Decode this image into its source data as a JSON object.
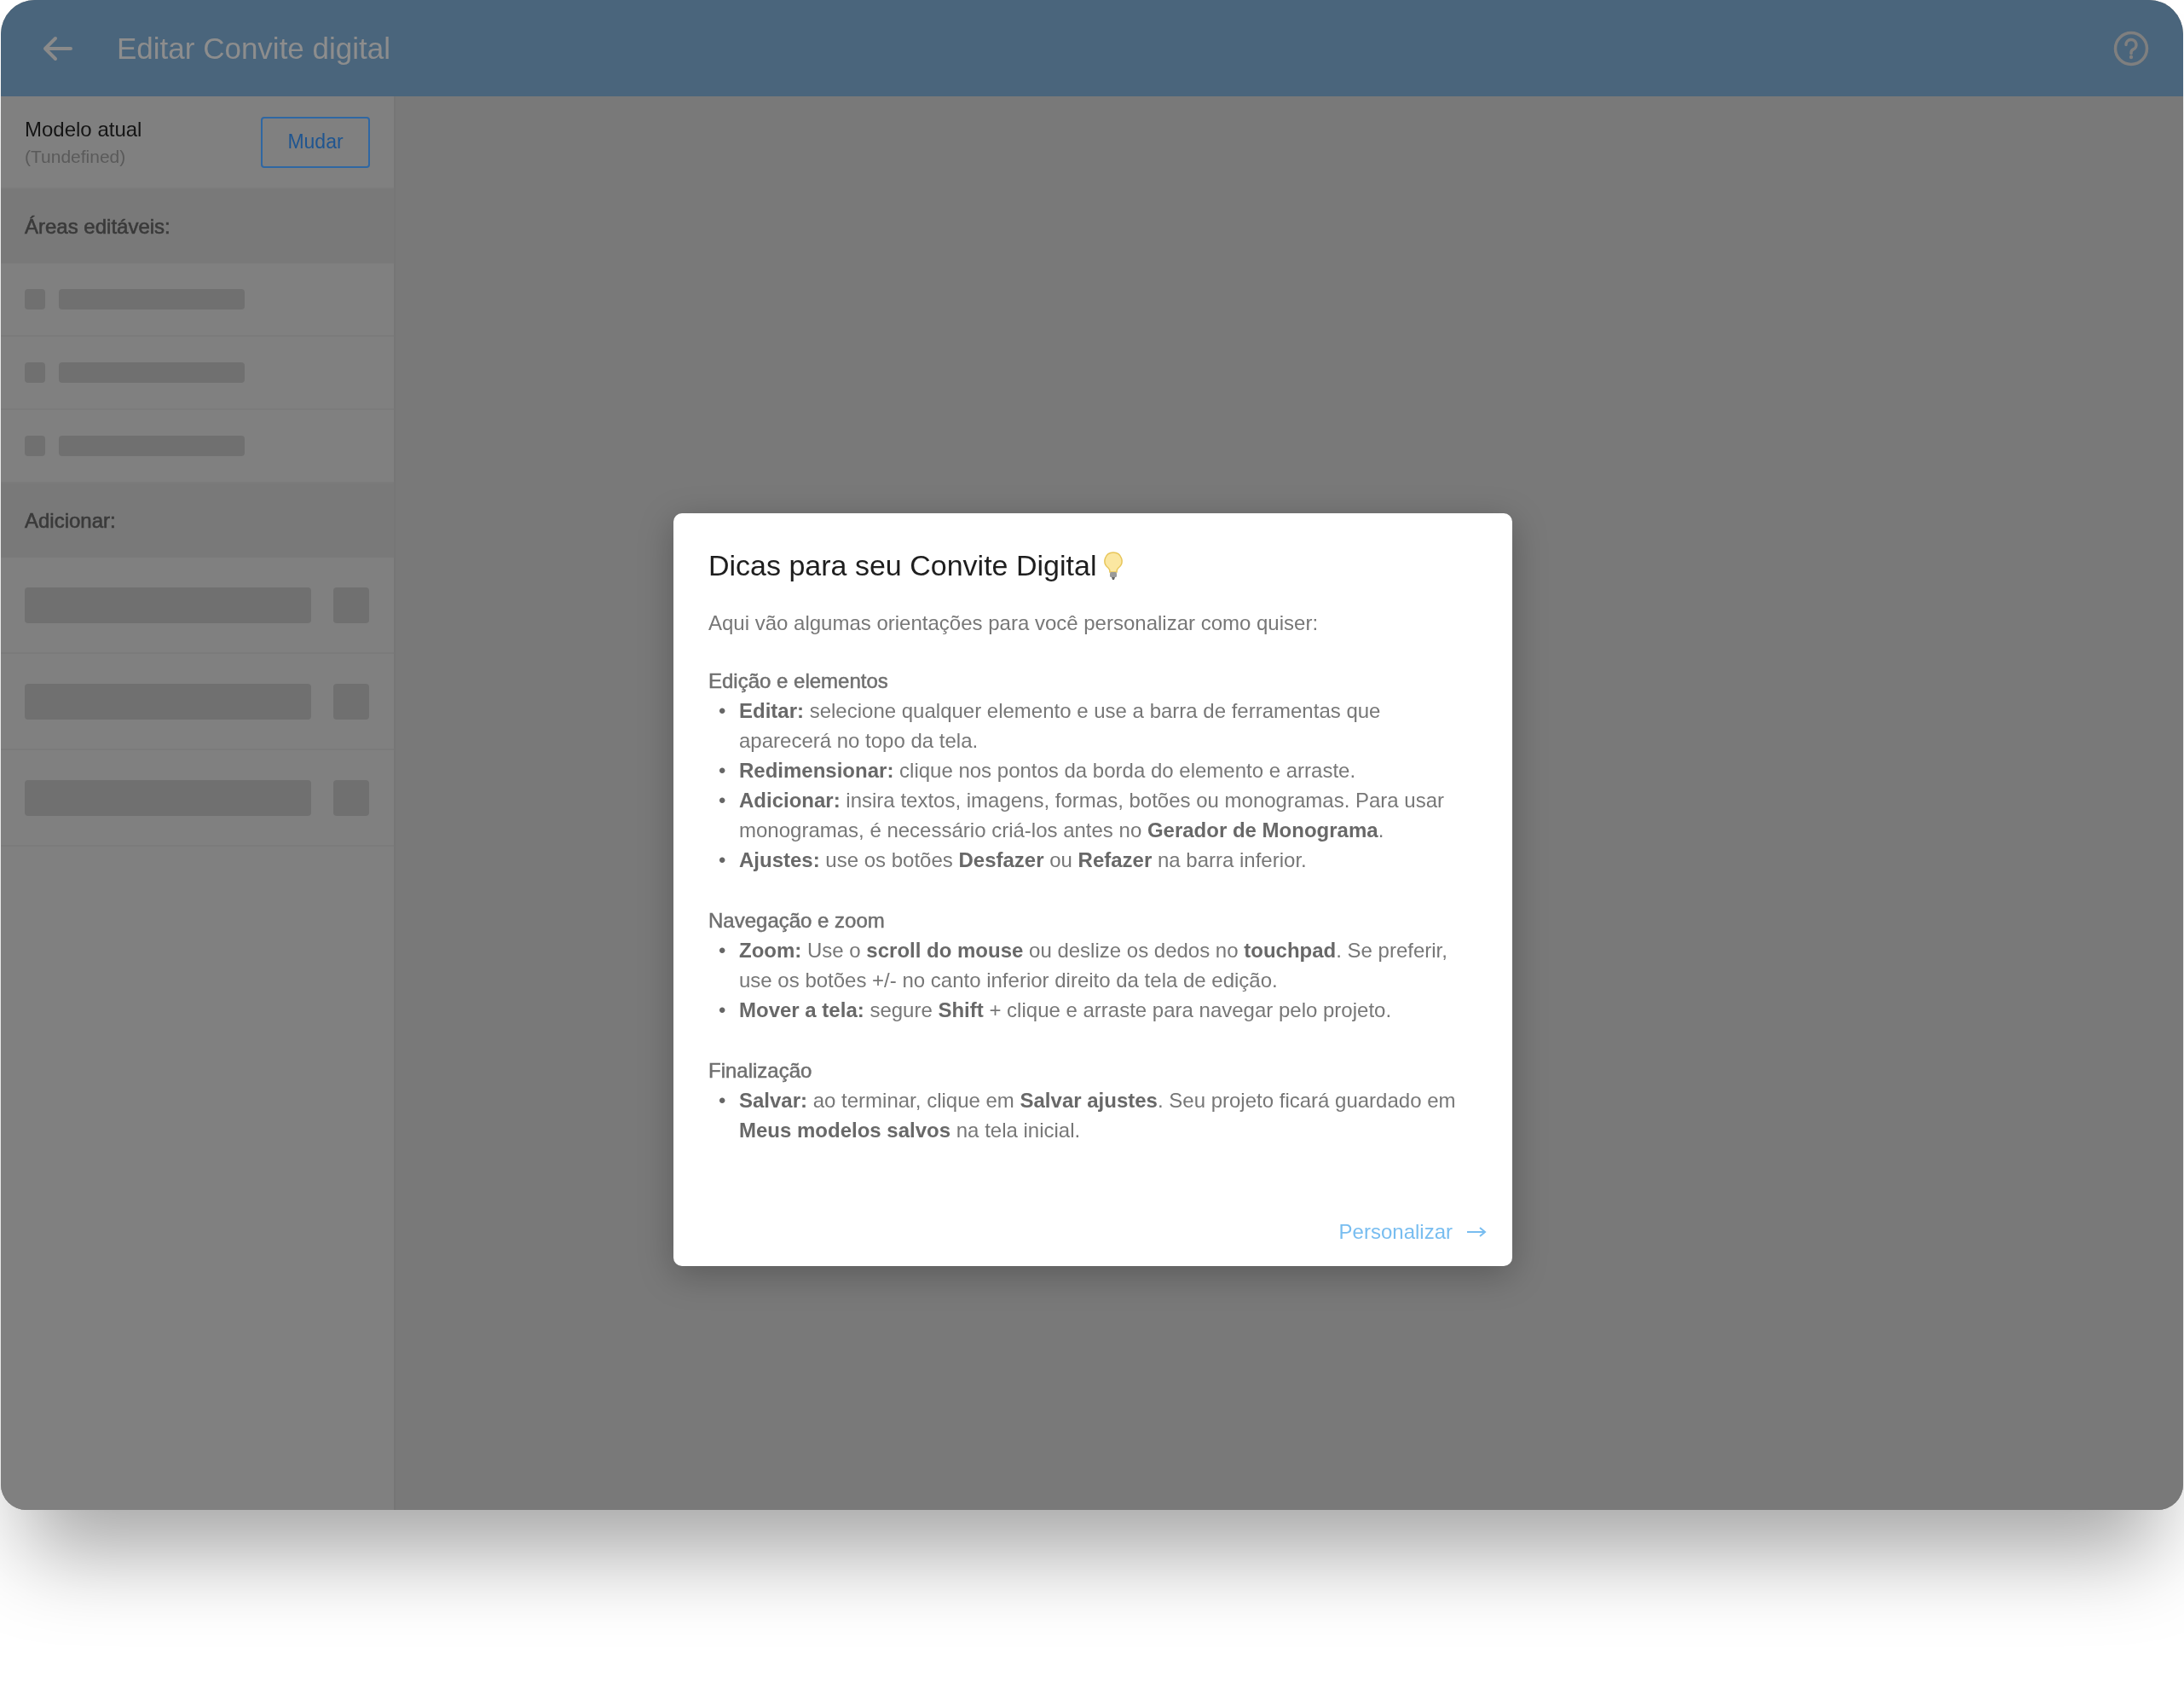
{
  "header": {
    "title": "Editar Convite digital"
  },
  "sidebar": {
    "model": {
      "label": "Modelo atual",
      "value": "(Tundefined)",
      "button": "Mudar"
    },
    "editable_areas": {
      "title": "Áreas editáveis:",
      "rows": [
        {
          "kind": "skeleton"
        },
        {
          "kind": "skeleton"
        },
        {
          "kind": "skeleton"
        }
      ]
    },
    "add": {
      "title": "Adicionar:",
      "rows": [
        {
          "kind": "skeleton"
        },
        {
          "kind": "skeleton"
        },
        {
          "kind": "skeleton"
        }
      ]
    }
  },
  "modal": {
    "title": "Dicas para seu Convite Digital",
    "intro": "Aqui vão algumas orientações para você personalizar como quiser:",
    "sections": [
      {
        "heading": "Edição e elementos",
        "items": [
          {
            "bullet": "•",
            "text": "**Editar:** selecione qualquer elemento e use a barra de ferramentas que aparecerá no topo da tela."
          },
          {
            "bullet": "•",
            "text": "**Redimensionar:** clique nos pontos da borda do elemento e arraste."
          },
          {
            "bullet": "•",
            "text": "**Adicionar:** insira textos, imagens, formas, botões ou monogramas. Para usar monogramas, é necessário criá-los antes no **Gerador de Monograma**."
          },
          {
            "bullet": "•",
            "text": "**Ajustes:** use os botões **Desfazer** ou **Refazer** na barra inferior."
          }
        ]
      },
      {
        "heading": "Navegação e zoom",
        "items": [
          {
            "bullet": "•",
            "text": "**Zoom:** Use o **scroll do mouse** ou deslize os dedos no **touchpad**. Se preferir, use os botões +/- no canto inferior direito da tela de edição."
          },
          {
            "bullet": "•",
            "text": "**Mover a tela:** segure **Shift** + clique e arraste para navegar pelo projeto."
          }
        ]
      },
      {
        "heading": "Finalização",
        "items": [
          {
            "bullet": "•",
            "text": "**Salvar:** ao terminar, clique em **Salvar ajustes**. Seu projeto ficará guardado em **Meus modelos salvos** na tela inicial."
          }
        ]
      }
    ],
    "action": {
      "label": "Personalizar"
    }
  }
}
